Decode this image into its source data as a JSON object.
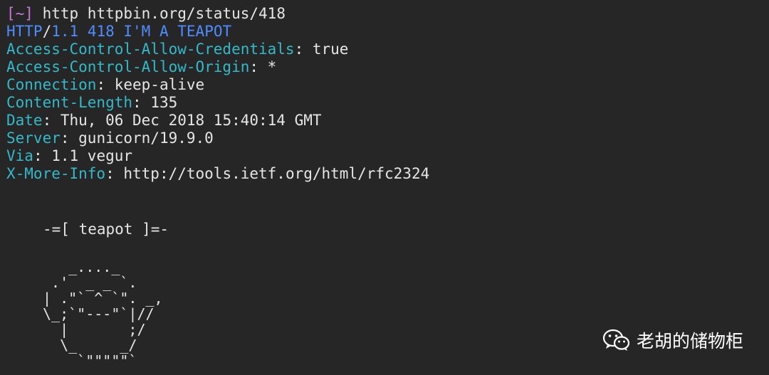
{
  "prompt": {
    "bracket": "[~]",
    "command": "http httpbin.org/status/418"
  },
  "status_line": {
    "protocol": "HTTP",
    "slash": "/",
    "version": "1.1",
    "code_reason": "418 I'M A TEAPOT"
  },
  "headers": [
    {
      "name": "Access-Control-Allow-Credentials",
      "value": "true"
    },
    {
      "name": "Access-Control-Allow-Origin",
      "value": "*"
    },
    {
      "name": "Connection",
      "value": "keep-alive"
    },
    {
      "name": "Content-Length",
      "value": "135"
    },
    {
      "name": "Date",
      "value": "Thu, 06 Dec 2018 15:40:14 GMT"
    },
    {
      "name": "Server",
      "value": "gunicorn/19.9.0"
    },
    {
      "name": "Via",
      "value": "1.1 vegur"
    },
    {
      "name": "X-More-Info",
      "value": "http://tools.ietf.org/html/rfc2324"
    }
  ],
  "body": {
    "title": "-=[ teapot ]=-",
    "ascii_art": "   _...._\n .'  _ _ `.\n| .\"` ^ `\". _,\n\\_;`\"---\"`|//\n  |       ;/\n  \\_     _/\n    `\"\"\"\"\"`"
  },
  "watermark": {
    "icon": "wechat-icon",
    "text": "老胡的储物柜"
  },
  "colors": {
    "background": "#262626",
    "text": "#e6e6e6",
    "header_name": "#33b9c9",
    "status": "#4f8cff",
    "prompt_bracket": "#c678dd"
  }
}
